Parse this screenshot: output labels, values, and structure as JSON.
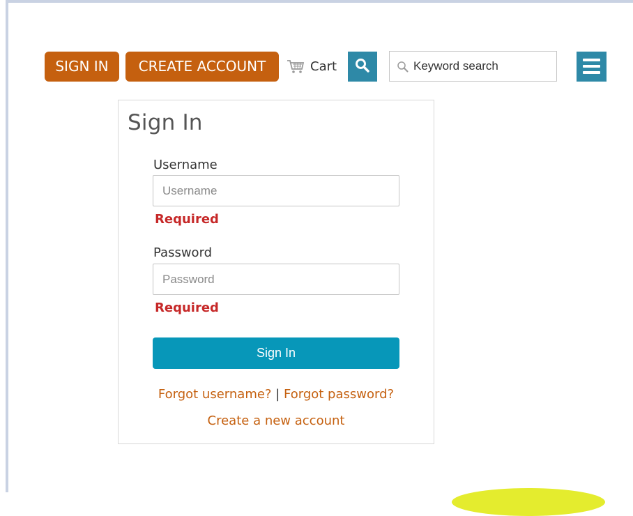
{
  "header": {
    "sign_in_label": "SIGN IN",
    "create_account_label": "CREATE ACCOUNT",
    "cart_label": "Cart",
    "search_placeholder": "Keyword search",
    "search_button_icon": "magnifier-icon",
    "menu_icon": "hamburger-icon"
  },
  "signin_form": {
    "title": "Sign In",
    "username": {
      "label": "Username",
      "placeholder": "Username",
      "value": "",
      "error": "Required"
    },
    "password": {
      "label": "Password",
      "placeholder": "Password",
      "value": "",
      "error": "Required"
    },
    "submit_label": "Sign In",
    "forgot_username": "Forgot username?",
    "separator": "|",
    "forgot_password": "Forgot password?",
    "create_account_link": "Create a new account"
  },
  "colors": {
    "brand_orange": "#c5600f",
    "accent_blue": "#2e89a7",
    "submit_blue": "#0797b9",
    "error_red": "#c62828"
  }
}
